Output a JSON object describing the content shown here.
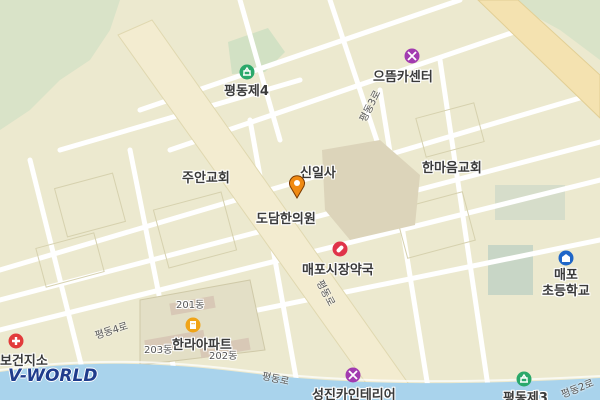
{
  "map": {
    "pois": [
      {
        "key": "pyeongdong4",
        "label": "평동제4",
        "icon": "park-icon"
      },
      {
        "key": "eutteum",
        "label": "으뜸카센터",
        "icon": "car-repair-icon"
      },
      {
        "key": "sinilsa",
        "label": "신일사"
      },
      {
        "key": "juan",
        "label": "주안교회"
      },
      {
        "key": "hanmaeum",
        "label": "한마음교회"
      },
      {
        "key": "dodam",
        "label": "도담한의원"
      },
      {
        "key": "pharmacy",
        "label": "매포시장약국",
        "icon": "pharmacy-icon"
      },
      {
        "key": "school",
        "label": "매포\n초등학교",
        "icon": "school-icon"
      },
      {
        "key": "hanra",
        "label": "한라아파트",
        "icon": "apartment-icon"
      },
      {
        "key": "bldg201",
        "label": "201동"
      },
      {
        "key": "bldg202",
        "label": "202동"
      },
      {
        "key": "bldg203",
        "label": "203동"
      },
      {
        "key": "health",
        "label": "보건지소",
        "icon": "hospital-icon"
      },
      {
        "key": "seongjin",
        "label": "성진카인테리어",
        "icon": "car-repair-icon"
      },
      {
        "key": "pyeongdong3",
        "label": "평동제3",
        "icon": "park-icon"
      }
    ],
    "roads": [
      "평동3로",
      "평동로",
      "평동4로",
      "평동로",
      "평동2로"
    ],
    "marker_icon": "location-marker-icon",
    "logo": "V-WORLD",
    "colors": {
      "land": "#ece9cf",
      "block": "#e7e3c3",
      "road": "#ffffff",
      "main_road": "#f3e9c5",
      "river": "#a9d3ec",
      "park": "#d6e6c9"
    }
  }
}
